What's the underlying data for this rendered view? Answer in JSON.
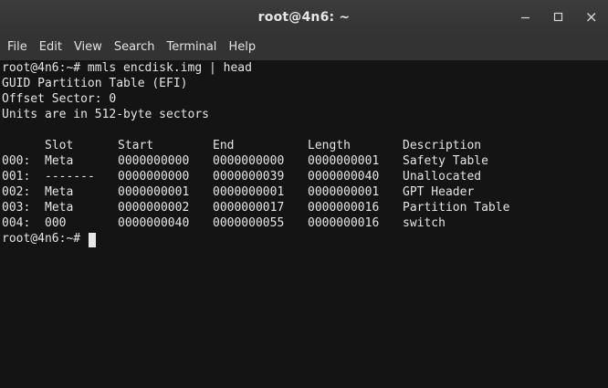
{
  "window": {
    "title": "root@4n6: ~"
  },
  "menu": [
    "File",
    "Edit",
    "View",
    "Search",
    "Terminal",
    "Help"
  ],
  "terminal": {
    "command_line": "root@4n6:~# mmls encdisk.img | head",
    "info": [
      "GUID Partition Table (EFI)",
      "Offset Sector: 0",
      "Units are in 512-byte sectors"
    ],
    "headers": [
      "Slot",
      "Start",
      "End",
      "Length",
      "Description"
    ],
    "rows": [
      [
        "000:",
        "Meta",
        "0000000000",
        "0000000000",
        "0000000001",
        "Safety Table"
      ],
      [
        "001:",
        "-------",
        "0000000000",
        "0000000039",
        "0000000040",
        "Unallocated"
      ],
      [
        "002:",
        "Meta",
        "0000000001",
        "0000000001",
        "0000000001",
        "GPT Header"
      ],
      [
        "003:",
        "Meta",
        "0000000002",
        "0000000017",
        "0000000016",
        "Partition Table"
      ],
      [
        "004:",
        "000",
        "0000000040",
        "0000000055",
        "0000000016",
        "switch"
      ]
    ],
    "prompt": "root@4n6:~#"
  },
  "colors": {
    "titlebar": "#383838",
    "menubar": "#333333",
    "terminal_bg": "#141414",
    "terminal_fg": "#e5e5e5"
  }
}
